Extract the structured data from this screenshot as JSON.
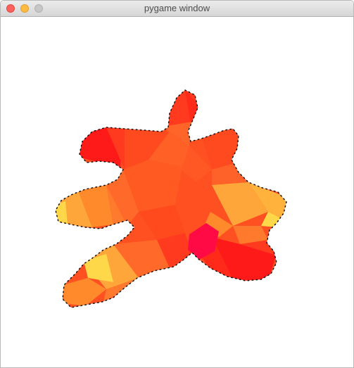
{
  "window": {
    "title": "pygame window"
  },
  "colors": {
    "red": "#ff1a1a",
    "red_orange": "#ff3a1e",
    "orange": "#ff5a22",
    "light_orange": "#ff8a2c",
    "amber": "#ffa63a",
    "yellow": "#ffd84a",
    "magenta_red": "#ff0a45",
    "outline": "#111111"
  },
  "controls": {
    "close": "close-icon",
    "minimize": "minimize-icon",
    "zoom": "zoom-icon"
  }
}
